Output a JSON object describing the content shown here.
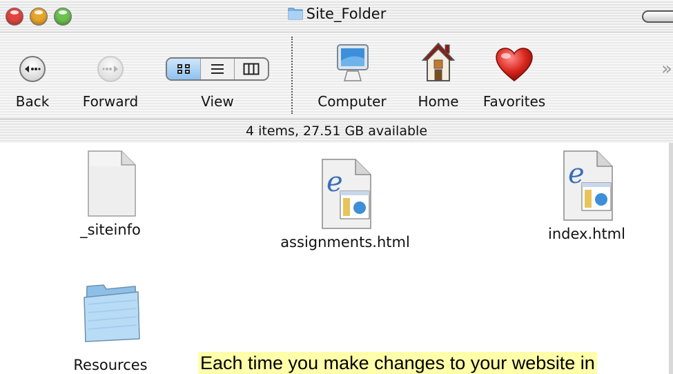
{
  "window": {
    "title": "Site_Folder",
    "traffic_lights": [
      {
        "name": "close",
        "color": "#e0443e"
      },
      {
        "name": "minimize",
        "color": "#e8a52c"
      },
      {
        "name": "zoom",
        "color": "#6bc04f"
      }
    ]
  },
  "toolbar": {
    "back_label": "Back",
    "forward_label": "Forward",
    "view_label": "View",
    "computer_label": "Computer",
    "home_label": "Home",
    "favorites_label": "Favorites",
    "view_modes": [
      "icon-view",
      "list-view",
      "column-view"
    ],
    "overflow_icon": "»"
  },
  "status": {
    "text": "4 items, 27.51 GB available"
  },
  "items": [
    {
      "name": "_siteinfo",
      "icon": "document-icon"
    },
    {
      "name": "assignments.html",
      "icon": "html-document-icon"
    },
    {
      "name": "index.html",
      "icon": "html-document-icon"
    },
    {
      "name": "Resources",
      "icon": "folder-icon"
    }
  ],
  "note": {
    "text": "Each time you make changes to your website in"
  },
  "colors": {
    "accent": "#8ec2f0",
    "highlight": "#ffffaa"
  }
}
